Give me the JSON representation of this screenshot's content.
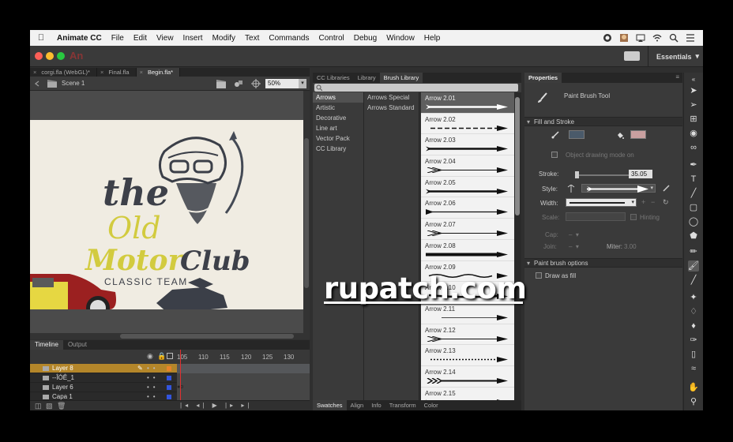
{
  "menubar": {
    "app": "Animate CC",
    "items": [
      "File",
      "Edit",
      "View",
      "Insert",
      "Modify",
      "Text",
      "Commands",
      "Control",
      "Debug",
      "Window",
      "Help"
    ]
  },
  "titlebar": {
    "logo": "An",
    "workspace": "Essentials"
  },
  "documents": {
    "tabs": [
      "corgi.fla (WebGL)*",
      "Final.fla",
      "Begin.fla*"
    ],
    "active_tab": "Begin.fla*"
  },
  "stage": {
    "scene": "Scene 1",
    "zoom": "50%",
    "artwork": {
      "the": "the",
      "old": "Old",
      "motor": "Motor",
      "club": "Club",
      "tagline": "CLASSIC TEAM"
    }
  },
  "timeline": {
    "tabs": [
      "Timeline",
      "Output"
    ],
    "frame_numbers": [
      "105",
      "110",
      "115",
      "120",
      "125",
      "130"
    ],
    "layers": [
      {
        "name": "Layer 8",
        "selected": true,
        "color": "#e8832a"
      },
      {
        "name": "--ÎÓÊ_1",
        "selected": false,
        "color": "#3355dd"
      },
      {
        "name": "Layer 6",
        "selected": false,
        "color": "#3355dd"
      },
      {
        "name": "Capa 1",
        "selected": false,
        "color": "#3355dd"
      }
    ]
  },
  "libraries": {
    "tabs": [
      "CC Libraries",
      "Library",
      "Brush Library"
    ],
    "active_tab": "Brush Library",
    "categories": [
      "Arrows",
      "Artistic",
      "Decorative",
      "Line art",
      "Vector Pack",
      "CC Library"
    ],
    "selected_category": "Arrows",
    "subcategories": [
      "Arrows Special",
      "Arrows Standard"
    ],
    "brushes": [
      "Arrow 2.01",
      "Arrow 2.02",
      "Arrow 2.03",
      "Arrow 2.04",
      "Arrow 2.05",
      "Arrow 2.06",
      "Arrow 2.07",
      "Arrow 2.08",
      "Arrow 2.09",
      "Arrow 2.10",
      "Arrow 2.11",
      "Arrow 2.12",
      "Arrow 2.13",
      "Arrow 2.14",
      "Arrow 2.15"
    ],
    "selected_brush": "Arrow 2.01",
    "bottom_tabs": [
      "Swatches",
      "Align",
      "Info",
      "Transform",
      "Color"
    ]
  },
  "properties": {
    "tab": "Properties",
    "tool_name": "Paint Brush Tool",
    "fill_stroke_header": "Fill and Stroke",
    "object_drawing_mode": "Object drawing mode on",
    "stroke_label": "Stroke:",
    "stroke_value": "35.05",
    "style_label": "Style:",
    "width_label": "Width:",
    "scale_label": "Scale:",
    "hinting_label": "Hinting",
    "cap_label": "Cap:",
    "join_label": "Join:",
    "miter_label": "Miter:",
    "miter_value": "3.00",
    "brush_options_header": "Paint brush options",
    "draw_as_fill": "Draw as fill",
    "stroke_color": "#4a5a6a",
    "fill_color": "#c9a0a0"
  },
  "watermark": "rupatch.com"
}
